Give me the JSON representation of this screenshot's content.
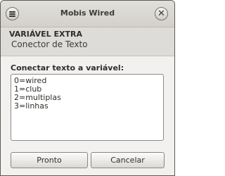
{
  "window": {
    "title": "Mobis Wired"
  },
  "header": {
    "title": "VARIÁVEL EXTRA",
    "subtitle": "Conector de Texto"
  },
  "form": {
    "label": "Conectar texto a variável:",
    "lines": [
      "0=wired",
      "1=club",
      "2=multiplas",
      "3=linhas"
    ]
  },
  "buttons": {
    "ok": "Pronto",
    "cancel": "Cancelar"
  },
  "icons": {
    "menu": "menu-icon",
    "close": "close-icon"
  }
}
